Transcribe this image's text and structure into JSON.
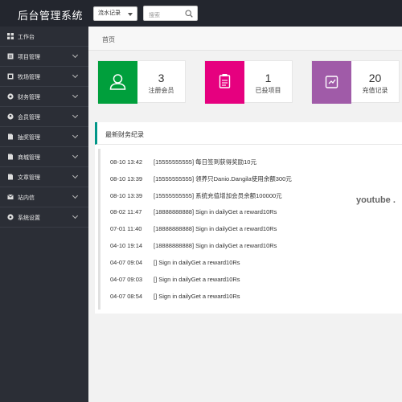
{
  "app": {
    "title": "后台管理系统"
  },
  "toolbar": {
    "select_value": "流水记录",
    "search_placeholder": "搜索"
  },
  "sidebar": {
    "items": [
      {
        "label": "工作台",
        "icon": "dashboard-icon",
        "expandable": false
      },
      {
        "label": "项目管理",
        "icon": "project-icon",
        "expandable": true
      },
      {
        "label": "牧场管理",
        "icon": "farm-icon",
        "expandable": true
      },
      {
        "label": "财务管理",
        "icon": "finance-icon",
        "expandable": true
      },
      {
        "label": "会员管理",
        "icon": "member-icon",
        "expandable": true
      },
      {
        "label": "抽奖管理",
        "icon": "lottery-icon",
        "expandable": true
      },
      {
        "label": "商城管理",
        "icon": "shop-icon",
        "expandable": true
      },
      {
        "label": "文章管理",
        "icon": "article-icon",
        "expandable": true
      },
      {
        "label": "站内信",
        "icon": "message-icon",
        "expandable": true
      },
      {
        "label": "系统设置",
        "icon": "settings-icon",
        "expandable": true
      }
    ]
  },
  "breadcrumb": {
    "home": "首页"
  },
  "stats": [
    {
      "value": "3",
      "label": "注册会员",
      "color": "#009f3c",
      "icon": "user-icon"
    },
    {
      "value": "1",
      "label": "已投项目",
      "color": "#e6007f",
      "icon": "clipboard-icon"
    },
    {
      "value": "20",
      "label": "充值记录",
      "color": "#a05ba8",
      "icon": "recharge-icon"
    }
  ],
  "finance": {
    "title": "最新财务纪录",
    "rows": [
      {
        "time": "08-10 13:42",
        "text": "[15555555555] 每日签到获得奖励10元"
      },
      {
        "time": "08-10 13:39",
        "text": "[15555555555] 领养只Danio.Dangila使用余额300元"
      },
      {
        "time": "08-10 13:39",
        "text": "[15555555555] 系统充值增加会员余额100000元"
      },
      {
        "time": "08-02 11:47",
        "text": "[18888888888] Sign in dailyGet a reward10Rs"
      },
      {
        "time": "07-01 11:40",
        "text": "[18888888888] Sign in dailyGet a reward10Rs"
      },
      {
        "time": "04-10 19:14",
        "text": "[18888888888] Sign in dailyGet a reward10Rs"
      },
      {
        "time": "04-07 09:04",
        "text": "[] Sign in dailyGet a reward10Rs"
      },
      {
        "time": "04-07 09:03",
        "text": "[] Sign in dailyGet a reward10Rs"
      },
      {
        "time": "04-07 08:54",
        "text": "[] Sign in dailyGet a reward10Rs"
      }
    ]
  },
  "watermark": {
    "text": "youtube ."
  },
  "colors": {
    "topbar": "#23262e",
    "sidebar": "#2b2e36",
    "accent": "#009688"
  }
}
